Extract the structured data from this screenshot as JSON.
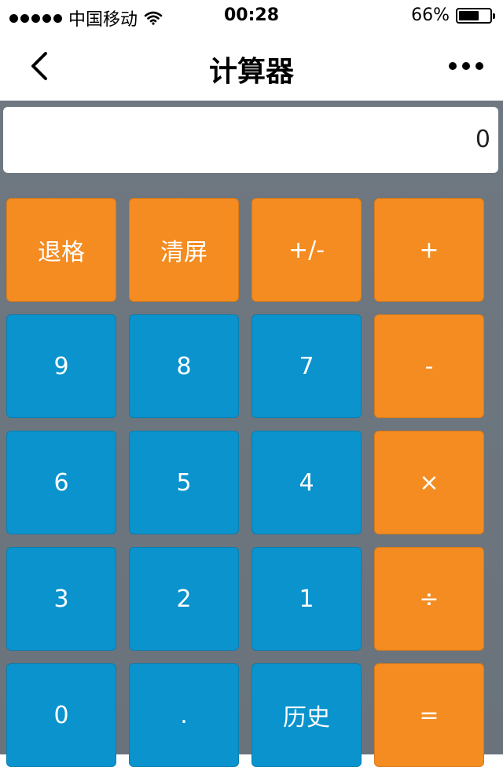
{
  "status_bar": {
    "carrier": "中国移动",
    "time": "00:28",
    "battery": "66%",
    "battery_level": 0.66
  },
  "nav": {
    "title": "计算器"
  },
  "display": {
    "value": "0"
  },
  "keys": [
    {
      "label": "退格",
      "color": "#f48c21"
    },
    {
      "label": "清屏",
      "color": "#f48c21"
    },
    {
      "label": "+/-",
      "color": "#f48c21"
    },
    {
      "label": "+",
      "color": "#f48c21"
    },
    {
      "label": "9",
      "color": "#0a93cd"
    },
    {
      "label": "8",
      "color": "#0a93cd"
    },
    {
      "label": "7",
      "color": "#0a93cd"
    },
    {
      "label": "-",
      "color": "#f48c21"
    },
    {
      "label": "6",
      "color": "#0a93cd"
    },
    {
      "label": "5",
      "color": "#0a93cd"
    },
    {
      "label": "4",
      "color": "#0a93cd"
    },
    {
      "label": "×",
      "color": "#f48c21"
    },
    {
      "label": "3",
      "color": "#0a93cd"
    },
    {
      "label": "2",
      "color": "#0a93cd"
    },
    {
      "label": "1",
      "color": "#0a93cd"
    },
    {
      "label": "÷",
      "color": "#f48c21"
    },
    {
      "label": "0",
      "color": "#0a93cd"
    },
    {
      "label": ".",
      "color": "#0a93cd"
    },
    {
      "label": "历史",
      "color": "#0a93cd"
    },
    {
      "label": "=",
      "color": "#f48c21"
    }
  ],
  "colors": {
    "accent_orange": "#f48c21",
    "accent_blue": "#0a93cd",
    "background": "#6f7880"
  }
}
